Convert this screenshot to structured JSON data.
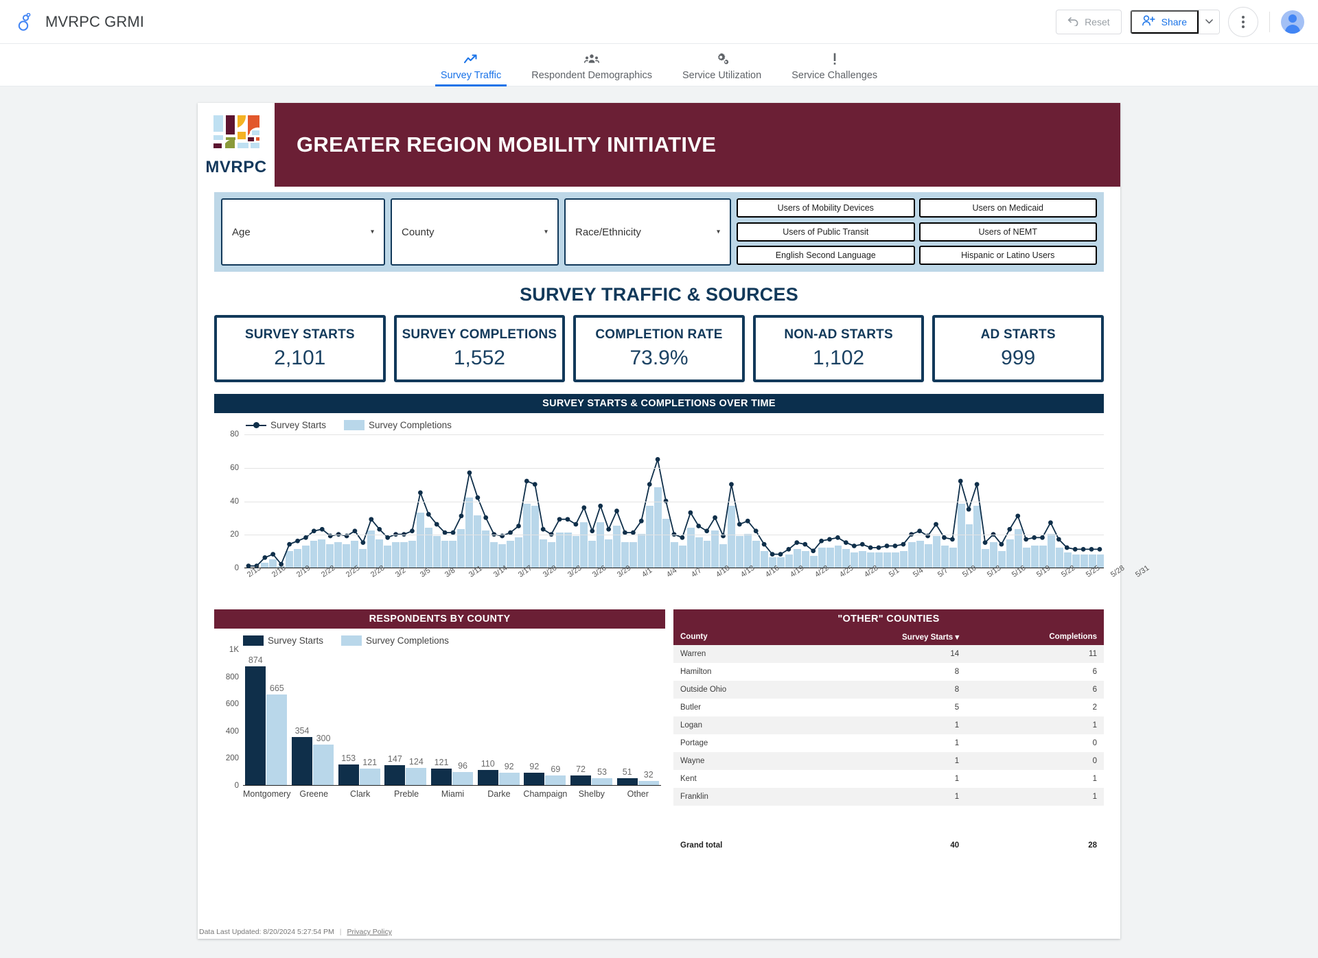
{
  "app": {
    "title": "MVRPC GRMI",
    "logo_icon": "looker-studio-icon",
    "reset_label": "Reset",
    "reset_icon": "undo-icon",
    "share_label": "Share",
    "share_icon": "person-add-icon",
    "share_caret_icon": "chevron-down-icon",
    "more_icon": "more-vert-icon",
    "avatar_icon": "user-avatar"
  },
  "tabs": [
    {
      "label": "Survey Traffic",
      "icon": "trending-up-icon",
      "active": true
    },
    {
      "label": "Respondent Demographics",
      "icon": "people-icon",
      "active": false
    },
    {
      "label": "Service Utilization",
      "icon": "settings-gear-icon",
      "active": false
    },
    {
      "label": "Service Challenges",
      "icon": "exclamation-icon",
      "active": false
    }
  ],
  "banner": {
    "logo_word": "MVRPC",
    "title": "GREATER REGION MOBILITY INITIATIVE",
    "bg_color": "#6b1f35"
  },
  "filters": {
    "dropdowns": [
      {
        "label": "Age",
        "caret_icon": "caret-down-icon"
      },
      {
        "label": "County",
        "caret_icon": "caret-down-icon"
      },
      {
        "label": "Race/Ethnicity",
        "caret_icon": "caret-down-icon"
      }
    ],
    "chips": [
      "Users of Mobility Devices",
      "Users on Medicaid",
      "Users of Public Transit",
      "Users of NEMT",
      "English Second Language",
      "Hispanic or Latino Users"
    ],
    "strip_color": "#bdd7e7"
  },
  "section": {
    "title": "SURVEY TRAFFIC & SOURCES",
    "timeseries_header": "SURVEY STARTS & COMPLETIONS OVER TIME",
    "county_header": "RESPONDENTS BY COUNTY",
    "other_counties_header": "\"OTHER\" COUNTIES"
  },
  "kpis": [
    {
      "label": "SURVEY STARTS",
      "value": "2,101"
    },
    {
      "label": "SURVEY COMPLETIONS",
      "value": "1,552"
    },
    {
      "label": "COMPLETION RATE",
      "value": "73.9%"
    },
    {
      "label": "NON-AD STARTS",
      "value": "1,102"
    },
    {
      "label": "AD STARTS",
      "value": "999"
    }
  ],
  "legend": {
    "starts": "Survey Starts",
    "completions": "Survey Completions",
    "starts_color": "#0f2f4a",
    "completions_color": "#b9d7ea"
  },
  "table": {
    "headers": {
      "county": "County",
      "starts": "Survey Starts",
      "completions": "Completions",
      "sort_icon": "caret-down-icon"
    },
    "rows": [
      {
        "county": "Warren",
        "starts": "14",
        "completions": "11"
      },
      {
        "county": "Hamilton",
        "starts": "8",
        "completions": "6"
      },
      {
        "county": "Outside Ohio",
        "starts": "8",
        "completions": "6"
      },
      {
        "county": "Butler",
        "starts": "5",
        "completions": "2"
      },
      {
        "county": "Logan",
        "starts": "1",
        "completions": "1"
      },
      {
        "county": "Portage",
        "starts": "1",
        "completions": "0"
      },
      {
        "county": "Wayne",
        "starts": "1",
        "completions": "0"
      },
      {
        "county": "Kent",
        "starts": "1",
        "completions": "1"
      },
      {
        "county": "Franklin",
        "starts": "1",
        "completions": "1"
      }
    ],
    "total": {
      "label": "Grand total",
      "starts": "40",
      "completions": "28"
    }
  },
  "footer": {
    "updated": "Data Last Updated: 8/20/2024 5:27:54 PM",
    "privacy": "Privacy Policy"
  },
  "chart_data": [
    {
      "type": "line",
      "id": "survey-starts-completions-over-time",
      "title": "SURVEY STARTS & COMPLETIONS OVER TIME",
      "xlabel": "",
      "ylabel": "",
      "ylim": [
        0,
        80
      ],
      "yticks": [
        0,
        20,
        40,
        60,
        80
      ],
      "grid": true,
      "legend": [
        "Survey Starts",
        "Survey Completions"
      ],
      "legend_position": "top-left",
      "x_tick_labels": [
        "2/13",
        "2/16",
        "2/19",
        "2/22",
        "2/25",
        "2/28",
        "3/2",
        "3/5",
        "3/8",
        "3/11",
        "3/14",
        "3/17",
        "3/20",
        "3/23",
        "3/26",
        "3/29",
        "4/1",
        "4/4",
        "4/7",
        "4/10",
        "4/13",
        "4/16",
        "4/19",
        "4/22",
        "4/25",
        "4/28",
        "5/1",
        "5/4",
        "5/7",
        "5/10",
        "5/13",
        "5/16",
        "5/19",
        "5/22",
        "5/25",
        "5/28",
        "5/31"
      ],
      "x_tick_every": 3,
      "x": [
        "2/13",
        "2/14",
        "2/15",
        "2/16",
        "2/17",
        "2/18",
        "2/19",
        "2/20",
        "2/21",
        "2/22",
        "2/23",
        "2/24",
        "2/25",
        "2/26",
        "2/27",
        "2/28",
        "2/29",
        "3/1",
        "3/2",
        "3/3",
        "3/4",
        "3/5",
        "3/6",
        "3/7",
        "3/8",
        "3/9",
        "3/10",
        "3/11",
        "3/12",
        "3/13",
        "3/14",
        "3/15",
        "3/16",
        "3/17",
        "3/18",
        "3/19",
        "3/20",
        "3/21",
        "3/22",
        "3/23",
        "3/24",
        "3/25",
        "3/26",
        "3/27",
        "3/28",
        "3/29",
        "3/30",
        "3/31",
        "4/1",
        "4/2",
        "4/3",
        "4/4",
        "4/5",
        "4/6",
        "4/7",
        "4/8",
        "4/9",
        "4/10",
        "4/11",
        "4/12",
        "4/13",
        "4/14",
        "4/15",
        "4/16",
        "4/17",
        "4/18",
        "4/19",
        "4/20",
        "4/21",
        "4/22",
        "4/23",
        "4/24",
        "4/25",
        "4/26",
        "4/27",
        "4/28",
        "4/29",
        "4/30",
        "5/1",
        "5/2",
        "5/3",
        "5/4",
        "5/5",
        "5/6",
        "5/7",
        "5/8",
        "5/9",
        "5/10",
        "5/11",
        "5/12",
        "5/13",
        "5/14",
        "5/15",
        "5/16",
        "5/17",
        "5/18",
        "5/19",
        "5/20",
        "5/21",
        "5/22",
        "5/23",
        "5/24",
        "5/25",
        "5/26",
        "5/27",
        "5/28",
        "5/29",
        "5/30",
        "5/31"
      ],
      "series": [
        {
          "name": "Survey Starts",
          "type": "line",
          "color": "#0f2f4a",
          "values": [
            1,
            1,
            6,
            8,
            2,
            14,
            16,
            18,
            22,
            23,
            19,
            20,
            19,
            22,
            15,
            29,
            23,
            18,
            20,
            20,
            22,
            45,
            32,
            26,
            21,
            21,
            31,
            57,
            42,
            30,
            20,
            19,
            21,
            25,
            52,
            50,
            23,
            20,
            29,
            29,
            26,
            36,
            22,
            37,
            23,
            34,
            21,
            21,
            28,
            50,
            65,
            40,
            20,
            18,
            33,
            25,
            22,
            30,
            19,
            50,
            26,
            28,
            22,
            14,
            8,
            8,
            11,
            15,
            14,
            10,
            16,
            17,
            18,
            15,
            13,
            14,
            12,
            12,
            13,
            13,
            14,
            20,
            22,
            19,
            26,
            18,
            17,
            52,
            35,
            50,
            15,
            20,
            14,
            23,
            31,
            17,
            18,
            18,
            27,
            17,
            12,
            11,
            11,
            11,
            11
          ]
        },
        {
          "name": "Survey Completions",
          "type": "bar",
          "color": "#b9d7ea",
          "values": [
            0,
            0,
            3,
            5,
            1,
            10,
            11,
            13,
            16,
            17,
            14,
            15,
            14,
            16,
            11,
            22,
            17,
            13,
            15,
            15,
            16,
            33,
            24,
            19,
            16,
            16,
            23,
            42,
            31,
            22,
            15,
            14,
            16,
            18,
            38,
            37,
            17,
            15,
            21,
            21,
            19,
            27,
            16,
            27,
            17,
            25,
            15,
            15,
            20,
            37,
            48,
            29,
            15,
            13,
            24,
            18,
            16,
            22,
            14,
            37,
            19,
            20,
            16,
            10,
            6,
            6,
            8,
            11,
            10,
            7,
            12,
            12,
            13,
            11,
            9,
            10,
            9,
            9,
            9,
            9,
            10,
            15,
            16,
            14,
            19,
            13,
            12,
            38,
            26,
            37,
            11,
            15,
            10,
            17,
            23,
            12,
            13,
            13,
            20,
            12,
            9,
            8,
            8,
            8,
            8
          ]
        }
      ]
    },
    {
      "type": "bar",
      "id": "respondents-by-county",
      "title": "RESPONDENTS BY COUNTY",
      "xlabel": "",
      "ylabel": "",
      "ylim": [
        0,
        1000
      ],
      "yticks": [
        0,
        200,
        400,
        600,
        800,
        1000
      ],
      "ytick_labels": [
        "0",
        "200",
        "400",
        "600",
        "800",
        "1K"
      ],
      "grid": false,
      "legend": [
        "Survey Starts",
        "Survey Completions"
      ],
      "legend_position": "top-left",
      "categories": [
        "Montgomery",
        "Greene",
        "Clark",
        "Preble",
        "Miami",
        "Darke",
        "Champaign",
        "Shelby",
        "Other"
      ],
      "series": [
        {
          "name": "Survey Starts",
          "color": "#0f2f4a",
          "values": [
            874,
            354,
            153,
            147,
            121,
            110,
            92,
            72,
            51
          ]
        },
        {
          "name": "Survey Completions",
          "color": "#b9d7ea",
          "values": [
            665,
            300,
            121,
            124,
            96,
            92,
            69,
            53,
            32
          ]
        }
      ]
    },
    {
      "type": "table",
      "id": "other-counties-table",
      "title": "\"OTHER\" COUNTIES",
      "columns": [
        "County",
        "Survey Starts",
        "Completions"
      ],
      "rows": [
        [
          "Warren",
          14,
          11
        ],
        [
          "Hamilton",
          8,
          6
        ],
        [
          "Outside Ohio",
          8,
          6
        ],
        [
          "Butler",
          5,
          2
        ],
        [
          "Logan",
          1,
          1
        ],
        [
          "Portage",
          1,
          0
        ],
        [
          "Wayne",
          1,
          0
        ],
        [
          "Kent",
          1,
          1
        ],
        [
          "Franklin",
          1,
          1
        ]
      ],
      "total_row": [
        "Grand total",
        40,
        28
      ],
      "sorted_by": "Survey Starts",
      "sort_direction": "desc"
    }
  ]
}
